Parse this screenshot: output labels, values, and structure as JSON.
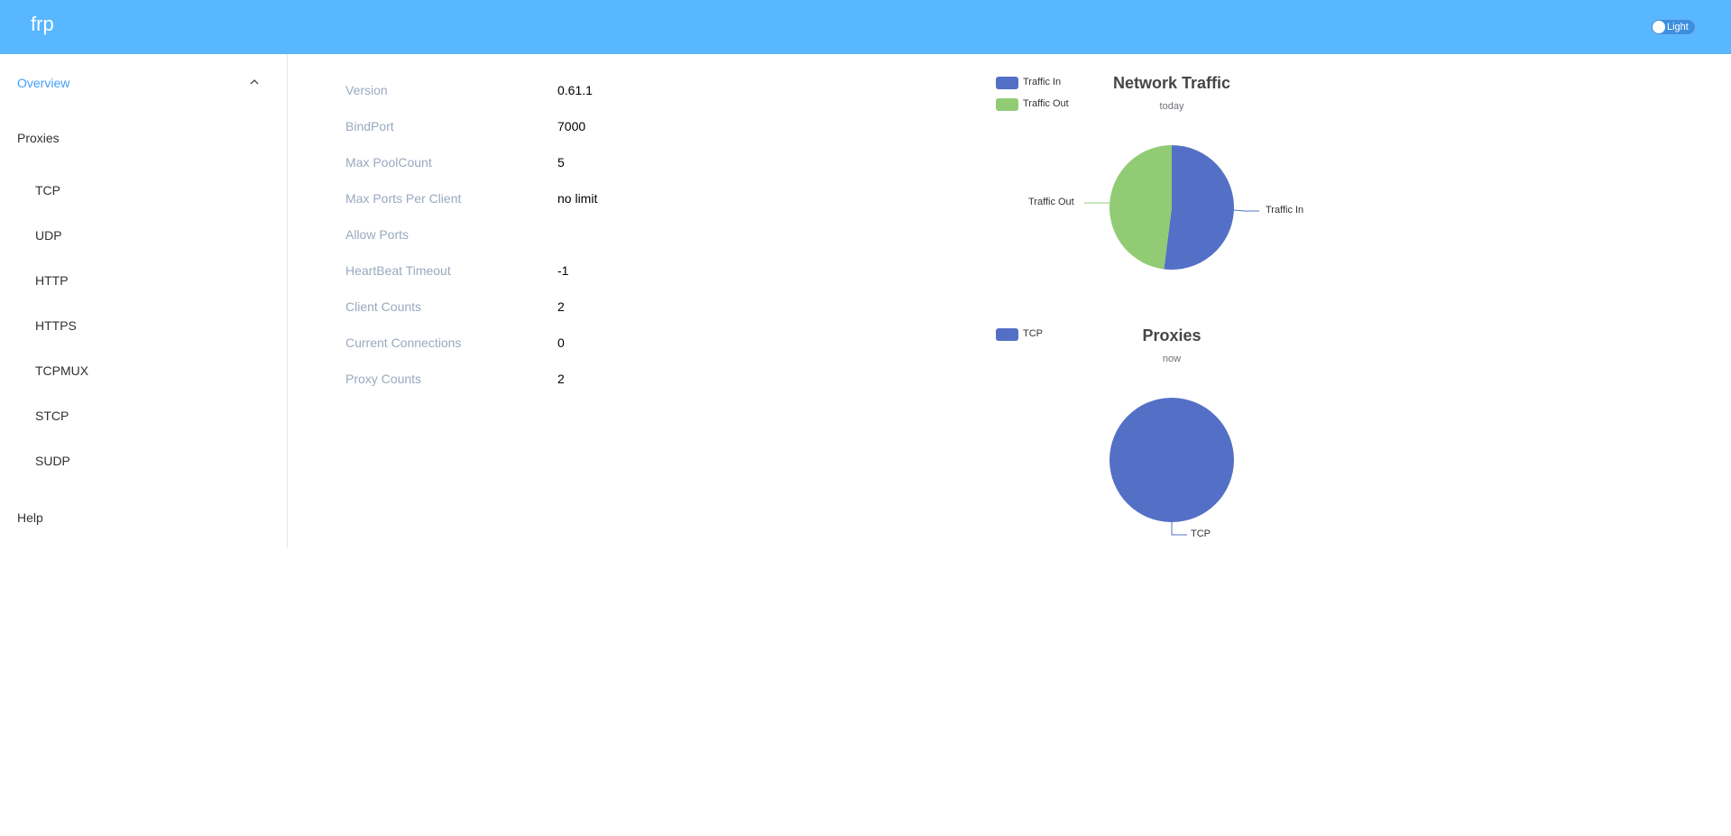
{
  "header": {
    "brand": "frp",
    "theme_label": "Light"
  },
  "sidebar": {
    "overview": "Overview",
    "proxies": "Proxies",
    "proxy_items": [
      "TCP",
      "UDP",
      "HTTP",
      "HTTPS",
      "TCPMUX",
      "STCP",
      "SUDP"
    ],
    "help": "Help"
  },
  "info": [
    {
      "label": "Version",
      "value": "0.61.1"
    },
    {
      "label": "BindPort",
      "value": "7000"
    },
    {
      "label": "Max PoolCount",
      "value": "5"
    },
    {
      "label": "Max Ports Per Client",
      "value": "no limit"
    },
    {
      "label": "Allow Ports",
      "value": ""
    },
    {
      "label": "HeartBeat Timeout",
      "value": "-1"
    },
    {
      "label": "Client Counts",
      "value": "2"
    },
    {
      "label": "Current Connections",
      "value": "0"
    },
    {
      "label": "Proxy Counts",
      "value": "2"
    }
  ],
  "colors": {
    "header": "#58b7ff",
    "active": "#409eff",
    "traffic_in": "#5470c6",
    "traffic_out": "#91cc75"
  },
  "chart_data": [
    {
      "type": "pie",
      "title": "Network Traffic",
      "subtitle": "today",
      "legend": "top-left",
      "categories": [
        "Traffic In",
        "Traffic Out"
      ],
      "values": [
        52,
        48
      ]
    },
    {
      "type": "pie",
      "title": "Proxies",
      "subtitle": "now",
      "legend": "top-left",
      "categories": [
        "TCP"
      ],
      "values": [
        100
      ]
    }
  ]
}
